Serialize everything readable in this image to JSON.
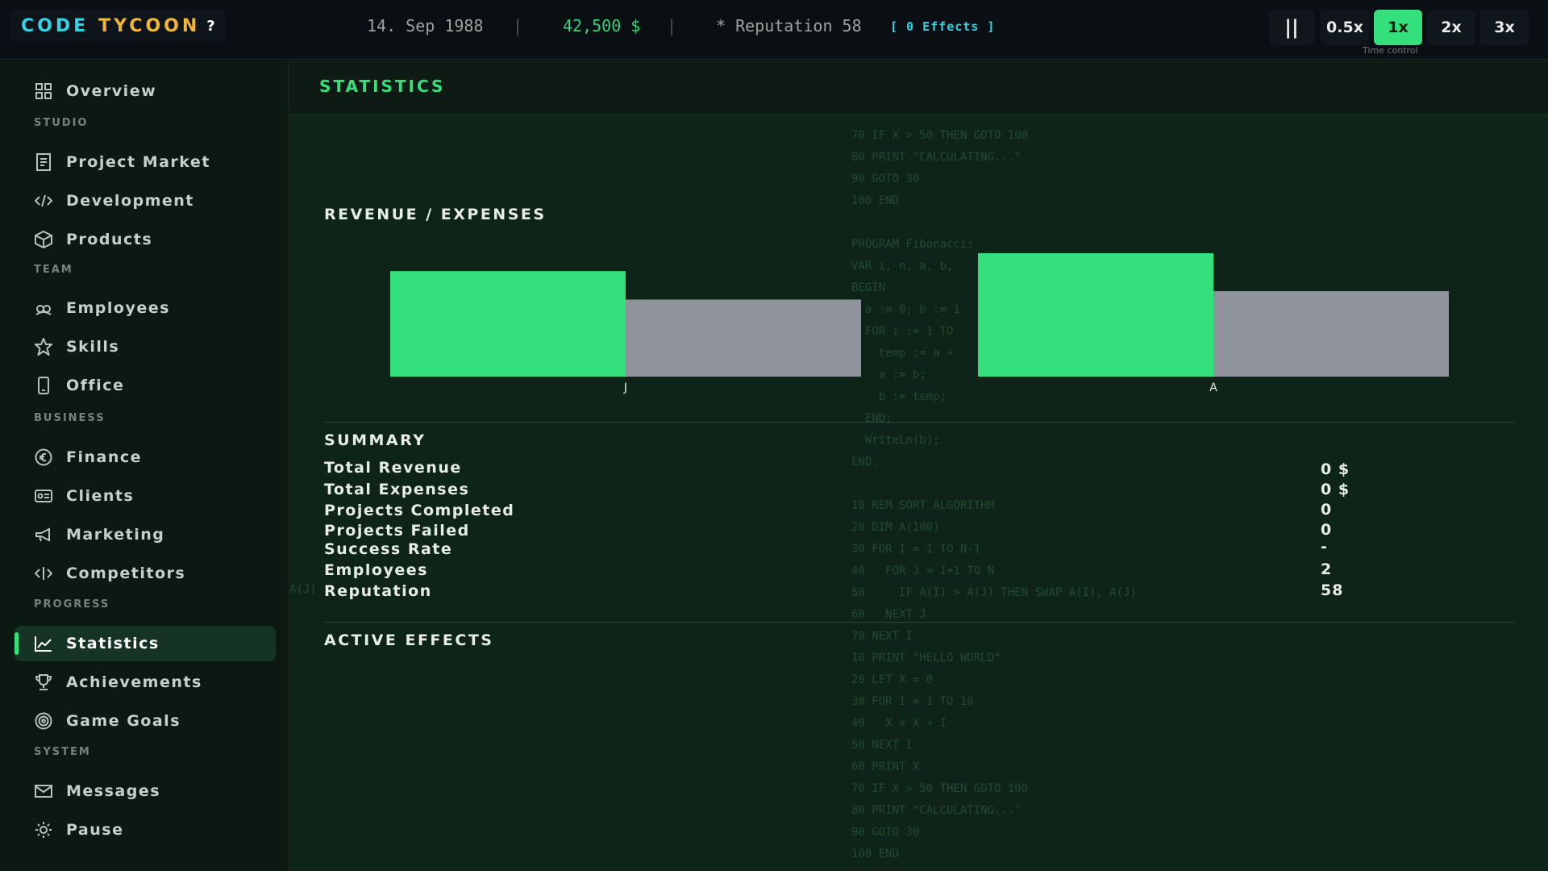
{
  "topbar": {
    "logo_part1": "CODE",
    "logo_part2": "TYCOON",
    "help": "?",
    "date": "14. Sep 1988",
    "separator": "|",
    "money": "42,500 $",
    "reputation": "* Reputation 58",
    "effects": "[ 0 Effects ]",
    "time_control": {
      "pause": "||",
      "speeds": [
        "0.5x",
        "1x",
        "2x",
        "3x"
      ],
      "active_speed": "1x",
      "label": "Time control"
    }
  },
  "sidebar": {
    "overview": "Overview",
    "sections": {
      "studio": "STUDIO",
      "team": "TEAM",
      "business": "BUSINESS",
      "progress": "PROGRESS",
      "system": "SYSTEM"
    },
    "items": {
      "project_market": "Project Market",
      "development": "Development",
      "products": "Products",
      "employees": "Employees",
      "skills": "Skills",
      "office": "Office",
      "finance": "Finance",
      "clients": "Clients",
      "marketing": "Marketing",
      "competitors": "Competitors",
      "statistics": "Statistics",
      "achievements": "Achievements",
      "game_goals": "Game Goals",
      "messages": "Messages",
      "pause": "Pause"
    },
    "active": "statistics"
  },
  "main": {
    "title": "STATISTICS",
    "revenue_title": "REVENUE / EXPENSES",
    "summary_title": "SUMMARY",
    "summary": [
      {
        "label": "Total Revenue",
        "value": "0 $"
      },
      {
        "label": "Total Expenses",
        "value": "0 $"
      },
      {
        "label": "Projects Completed",
        "value": "0"
      },
      {
        "label": "Projects Failed",
        "value": "0"
      },
      {
        "label": "Success Rate",
        "value": "-"
      },
      {
        "label": "Employees",
        "value": "2"
      },
      {
        "label": "Reputation",
        "value": "58"
      }
    ],
    "active_effects_title": "ACTIVE EFFECTS",
    "bg_code": "70 IF X > 50 THEN GOTO 100\n80 PRINT \"CALCULATING...\"\n90 GOTO 30\n100 END\n\nPROGRAM Fibonacci;\nVAR i, n, a, b,\nBEGIN\n  a := 0; b := 1\n  FOR i := 1 TO\n    temp := a +\n    a := b;\n    b := temp;\n  END;\n  WriteLn(b);\nEND.\n\n10 REM SORT ALGORITHM\n20 DIM A(100)\n30 FOR I = 1 TO N-1\n40   FOR J = I+1 TO N\n50     IF A(I) > A(J) THEN SWAP A(I), A(J)\n60   NEXT J\n70 NEXT I\n10 PRINT \"HELLO WORLD\"\n20 LET X = 0\n30 FOR I = 1 TO 10\n40   X = X + I\n50 NEXT I\n60 PRINT X\n70 IF X > 50 THEN GOTO 100\n80 PRINT \"CALCULATING...\"\n90 GOTO 30\n100 END",
    "bg_code_fragment": "A(J)"
  },
  "chart_data": {
    "type": "bar",
    "categories": [
      "J",
      "A"
    ],
    "series": [
      {
        "values": [
          100,
          117
        ],
        "color": "#34e07c"
      },
      {
        "values": [
          73,
          81
        ],
        "color": "#8e939c"
      }
    ],
    "ylim": [
      0,
      120
    ]
  },
  "icons": {
    "overview": "grid-icon",
    "project_market": "document-icon",
    "development": "code-icon",
    "products": "box-icon",
    "employees": "people-icon",
    "skills": "star-icon",
    "office": "building-icon",
    "finance": "euro-coin-icon",
    "clients": "id-card-icon",
    "marketing": "megaphone-icon",
    "competitors": "code-icon",
    "statistics": "chart-line-icon",
    "achievements": "trophy-icon",
    "game_goals": "target-icon",
    "messages": "mail-icon",
    "pause": "gear-icon"
  }
}
